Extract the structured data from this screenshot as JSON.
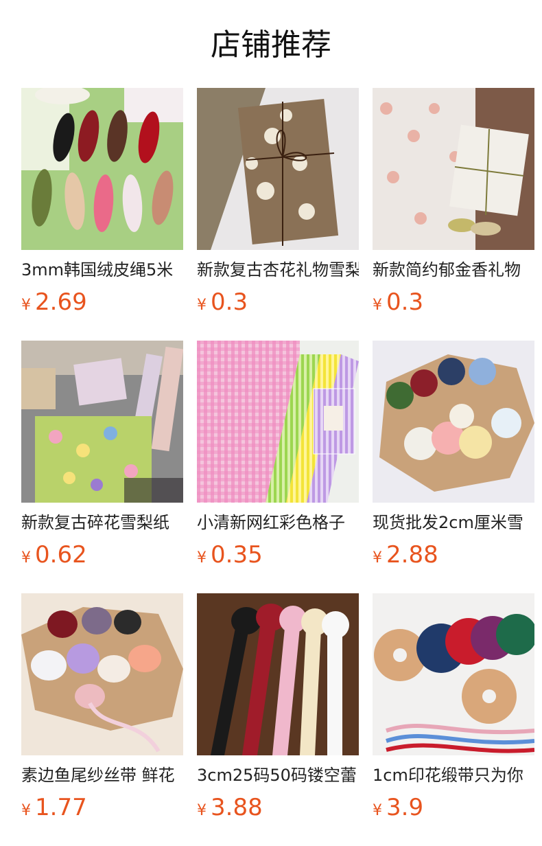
{
  "header": {
    "title": "店铺推荐"
  },
  "currency_symbol": "¥",
  "products": [
    {
      "name": "3mm韩国绒皮绳5米",
      "price": "2.69",
      "image": "colorful-cords-photo"
    },
    {
      "name": "新款复古杏花礼物雪梨",
      "price": "0.3",
      "image": "floral-wrap-gift-photo"
    },
    {
      "name": "新款简约郁金香礼物",
      "price": "0.3",
      "image": "tulip-wrap-gift-photo"
    },
    {
      "name": "新款复古碎花雪梨纸",
      "price": "0.62",
      "image": "ditsy-floral-paper-photo"
    },
    {
      "name": "小清新网红彩色格子",
      "price": "0.35",
      "image": "gingham-paper-photo"
    },
    {
      "name": "现货批发2cm厘米雪",
      "price": "2.88",
      "image": "organza-ribbon-rolls-photo"
    },
    {
      "name": "素边鱼尾纱丝带 鲜花",
      "price": "1.77",
      "image": "fishtail-chiffon-ribbon-photo"
    },
    {
      "name": "3cm25码50码镂空蕾",
      "price": "3.88",
      "image": "lace-ribbon-rolls-photo"
    },
    {
      "name": "1cm印花缎带只为你",
      "price": "3.9",
      "image": "printed-satin-ribbon-photo"
    }
  ]
}
